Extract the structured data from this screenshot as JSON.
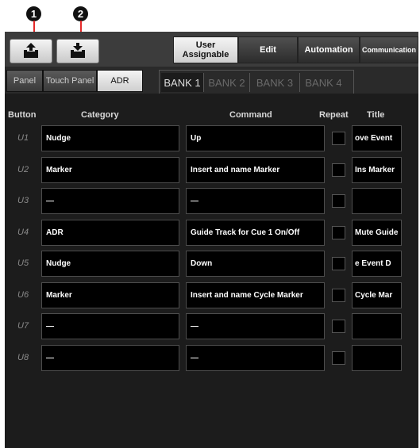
{
  "callouts": [
    "1",
    "2"
  ],
  "toolbar": {
    "export_icon": "export-icon",
    "import_icon": "import-icon"
  },
  "main_tabs": [
    {
      "label": "User Assignable",
      "active": true
    },
    {
      "label": "Edit",
      "active": false
    },
    {
      "label": "Automation",
      "active": false
    },
    {
      "label": "Communication",
      "active": false
    }
  ],
  "sub_tabs": [
    {
      "label": "Panel",
      "active": false
    },
    {
      "label": "Touch Panel",
      "active": false
    },
    {
      "label": "ADR",
      "active": true
    }
  ],
  "banks": [
    {
      "label": "BANK 1",
      "active": true
    },
    {
      "label": "BANK 2",
      "active": false
    },
    {
      "label": "BANK 3",
      "active": false
    },
    {
      "label": "BANK 4",
      "active": false
    }
  ],
  "headers": {
    "button": "Button",
    "category": "Category",
    "command": "Command",
    "repeat": "Repeat",
    "title": "Title"
  },
  "rows": [
    {
      "button": "U1",
      "category": "Nudge",
      "command": "Up",
      "title": "ove Event"
    },
    {
      "button": "U2",
      "category": "Marker",
      "command": "Insert and name Marker",
      "title": "Ins Marker"
    },
    {
      "button": "U3",
      "category": "—",
      "command": "—",
      "title": ""
    },
    {
      "button": "U4",
      "category": "ADR",
      "command": "Guide Track for Cue 1 On/Off",
      "title": "Mute Guide"
    },
    {
      "button": "U5",
      "category": "Nudge",
      "command": "Down",
      "title": "e Event D"
    },
    {
      "button": "U6",
      "category": "Marker",
      "command": "Insert and name Cycle Marker",
      "title": "Cycle Mar"
    },
    {
      "button": "U7",
      "category": "—",
      "command": "—",
      "title": ""
    },
    {
      "button": "U8",
      "category": "—",
      "command": "—",
      "title": ""
    }
  ]
}
